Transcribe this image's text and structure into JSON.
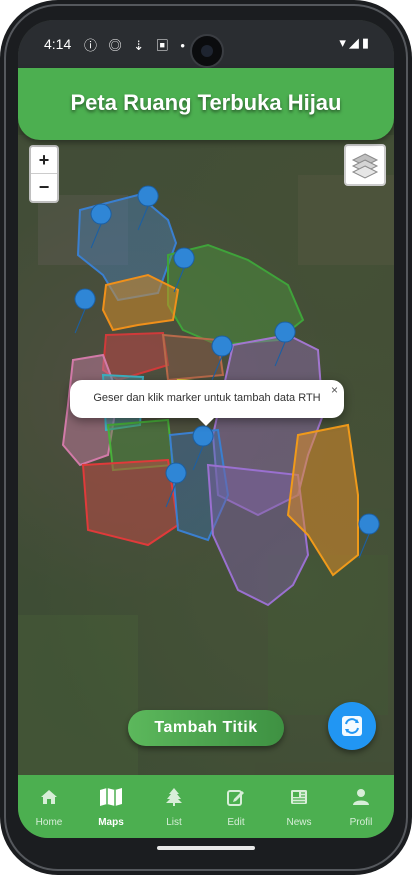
{
  "status_bar": {
    "time": "4:14"
  },
  "header": {
    "title": "Peta Ruang Terbuka Hijau"
  },
  "map": {
    "zoom_in_label": "+",
    "zoom_out_label": "−",
    "popup": {
      "text": "Geser dan klik marker untuk tambah data RTH",
      "close_label": "×"
    }
  },
  "actions": {
    "add_point_label": "Tambah Titik"
  },
  "nav": {
    "items": [
      {
        "label": "Home",
        "icon": "home-icon"
      },
      {
        "label": "Maps",
        "icon": "map-icon",
        "active": true
      },
      {
        "label": "List",
        "icon": "tree-icon"
      },
      {
        "label": "Edit",
        "icon": "edit-icon"
      },
      {
        "label": "News",
        "icon": "news-icon"
      },
      {
        "label": "Profil",
        "icon": "person-icon"
      }
    ]
  },
  "colors": {
    "primary": "#4caf50",
    "fab": "#2196f3",
    "marker": "#2f86d6"
  }
}
